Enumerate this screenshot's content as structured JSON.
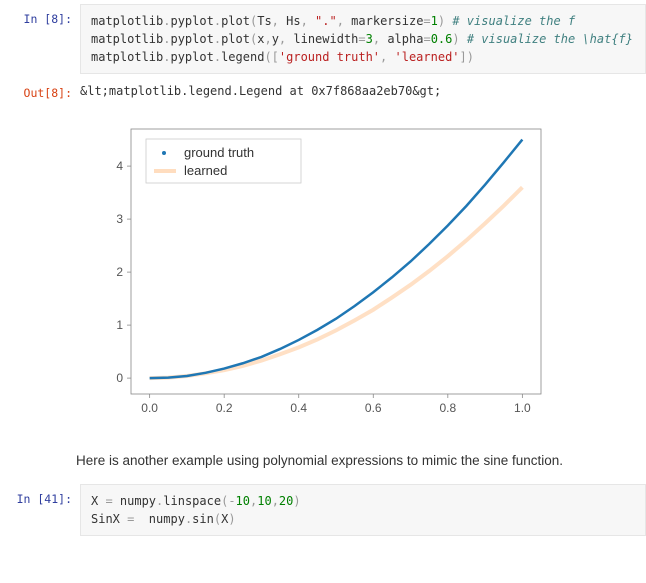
{
  "cell1": {
    "prompt": "In [8]:",
    "line1": {
      "t1": "matplotlib",
      "t2": ".",
      "t3": "pyplot",
      "t4": ".",
      "t5": "plot",
      "t6": "(",
      "t7": "Ts",
      "t8": ", ",
      "t9": "Hs",
      "t10": ", ",
      "t11": "\".\"",
      "t12": ", ",
      "t13": "markersize",
      "t14": "=",
      "t15": "1",
      "t16": ")",
      "t17": " # visualize the f"
    },
    "line2": {
      "t1": "matplotlib",
      "t2": ".",
      "t3": "pyplot",
      "t4": ".",
      "t5": "plot",
      "t6": "(",
      "t7": "x",
      "t8": ",",
      "t9": "y",
      "t10": ", ",
      "t11": "linewidth",
      "t12": "=",
      "t13": "3",
      "t14": ", ",
      "t15": "alpha",
      "t16": "=",
      "t17": "0.6",
      "t18": ")",
      "t19": " # visualize the \\hat{f}"
    },
    "line3": {
      "t1": "matplotlib",
      "t2": ".",
      "t3": "pyplot",
      "t4": ".",
      "t5": "legend",
      "t6": "([",
      "t7": "'ground truth'",
      "t8": ", ",
      "t9": "'learned'",
      "t10": "])"
    }
  },
  "out1": {
    "prompt": "Out[8]:",
    "text": "&lt;matplotlib.legend.Legend at 0x7f868aa2eb70&gt;"
  },
  "chart_data": {
    "type": "line",
    "xlim": [
      -0.05,
      1.05
    ],
    "ylim": [
      -0.3,
      4.7
    ],
    "xticks": [
      0.0,
      0.2,
      0.4,
      0.6,
      0.8,
      1.0
    ],
    "yticks": [
      0,
      1,
      2,
      3,
      4
    ],
    "legend": {
      "position": "upper-left",
      "entries": [
        "ground truth",
        "learned"
      ]
    },
    "series": [
      {
        "name": "ground truth",
        "style": "dot",
        "color": "#1f77b4",
        "x": [
          0.0,
          0.05,
          0.1,
          0.15,
          0.2,
          0.25,
          0.3,
          0.35,
          0.4,
          0.45,
          0.5,
          0.55,
          0.6,
          0.65,
          0.7,
          0.75,
          0.8,
          0.85,
          0.9,
          0.95,
          1.0
        ],
        "y": [
          0.0,
          0.01,
          0.04,
          0.1,
          0.18,
          0.28,
          0.4,
          0.55,
          0.72,
          0.91,
          1.12,
          1.36,
          1.62,
          1.9,
          2.2,
          2.53,
          2.88,
          3.25,
          3.65,
          4.07,
          4.5
        ]
      },
      {
        "name": "learned",
        "style": "line",
        "color": "#ffddbf",
        "linewidth": 3,
        "x": [
          0.0,
          0.05,
          0.1,
          0.15,
          0.2,
          0.25,
          0.3,
          0.35,
          0.4,
          0.45,
          0.5,
          0.55,
          0.6,
          0.65,
          0.7,
          0.75,
          0.8,
          0.85,
          0.9,
          0.95,
          1.0
        ],
        "y": [
          0.0,
          0.01,
          0.04,
          0.09,
          0.15,
          0.23,
          0.33,
          0.45,
          0.58,
          0.73,
          0.9,
          1.09,
          1.29,
          1.52,
          1.76,
          2.02,
          2.3,
          2.6,
          2.92,
          3.25,
          3.6
        ]
      }
    ]
  },
  "narrative": {
    "text": "Here is another example using polynomial expressions to mimic the sine function."
  },
  "cell2": {
    "prompt": "In [41]:",
    "line1": {
      "t1": "X ",
      "t2": "=",
      "t3": " numpy",
      "t4": ".",
      "t5": "linspace",
      "t6": "(",
      "t7": "-",
      "t8": "10",
      "t9": ",",
      "t10": "10",
      "t11": ",",
      "t12": "20",
      "t13": ")"
    },
    "line2": {
      "t1": "SinX ",
      "t2": "=",
      "t3": "  numpy",
      "t4": ".",
      "t5": "sin",
      "t6": "(",
      "t7": "X",
      "t8": ")"
    }
  }
}
